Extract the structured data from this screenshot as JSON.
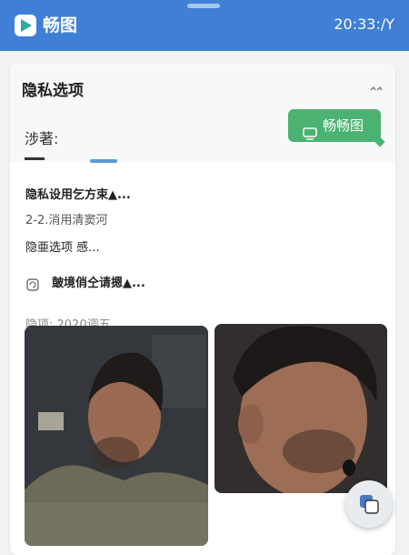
{
  "status_bar": {
    "app_name": "畅图",
    "time": "20:33:/Y"
  },
  "panel": {
    "title": "隐私选项",
    "field_label": "涉著:",
    "action_button": "畅畅图"
  },
  "menu": {
    "row1": "隐私设用乞方束▲...",
    "row2": "2-2.消用清窦河",
    "row3": "隐亜选项  感...",
    "row4": "皷境俏仝请摁▲...",
    "row5": "隐项: 2020调五"
  },
  "photos": [
    {
      "name": "portrait-left"
    },
    {
      "name": "portrait-right"
    }
  ],
  "colors": {
    "header_blue": "#3f7fd6",
    "button_green": "#4cb272"
  },
  "icons": [
    "play-logo-icon",
    "collapse-icon",
    "message-icon",
    "refresh-icon",
    "edit-icon"
  ]
}
